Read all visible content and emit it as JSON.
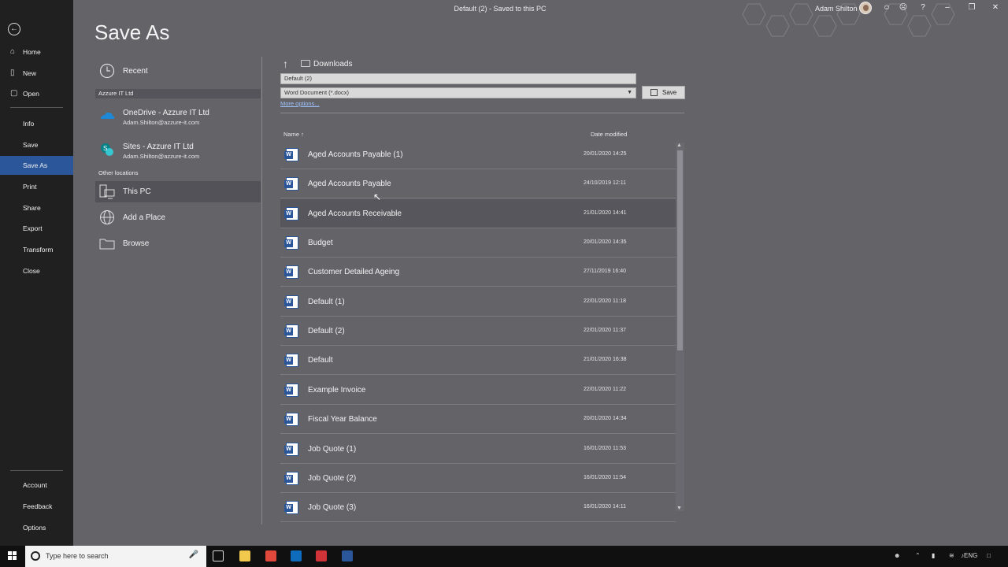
{
  "titlebar": {
    "doc_title": "Default (2)  -  Saved to this PC",
    "user_name": "Adam Shilton",
    "icons": [
      "smiley-icon",
      "frown-icon",
      "help-icon",
      "minimize-icon",
      "restore-icon",
      "close-icon"
    ],
    "glyphs": [
      "☺",
      "☹",
      "?",
      "–",
      "❐",
      "✕"
    ]
  },
  "nav": {
    "back_glyph": "←",
    "items": [
      {
        "label": "Home",
        "icon": "home-icon",
        "glyph": "⌂"
      },
      {
        "label": "New",
        "icon": "new-doc-icon",
        "glyph": "▯"
      },
      {
        "label": "Open",
        "icon": "folder-open-icon",
        "glyph": "▢"
      },
      {
        "label": "Info"
      },
      {
        "label": "Save"
      },
      {
        "label": "Save As"
      },
      {
        "label": "Print"
      },
      {
        "label": "Share"
      },
      {
        "label": "Export"
      },
      {
        "label": "Transform"
      },
      {
        "label": "Close"
      },
      {
        "label": "Account"
      },
      {
        "label": "Feedback"
      },
      {
        "label": "Options"
      }
    ]
  },
  "page": {
    "title": "Save As"
  },
  "locations": {
    "recent": "Recent",
    "group_org": "Azzure IT Ltd",
    "onedrive": {
      "name": "OneDrive - Azzure IT Ltd",
      "email": "Adam.Shilton@azzure-it.com"
    },
    "sites": {
      "name": "Sites - Azzure IT Ltd",
      "email": "Adam.Shilton@azzure-it.com"
    },
    "group_other": "Other locations",
    "this_pc": "This PC",
    "add_place": "Add a Place",
    "browse": "Browse"
  },
  "save_panel": {
    "folder": "Downloads",
    "filename": "Default (2)",
    "filetype": "Word Document (*.docx)",
    "more_options": "More options...",
    "save_label": "Save",
    "col_name": "Name",
    "col_date": "Date modified"
  },
  "files": [
    {
      "name": "Aged Accounts Payable (1)",
      "date": "20/01/2020 14:25"
    },
    {
      "name": "Aged Accounts Payable",
      "date": "24/10/2019 12:11"
    },
    {
      "name": "Aged Accounts Receivable",
      "date": "21/01/2020 14:41"
    },
    {
      "name": "Budget",
      "date": "20/01/2020 14:35"
    },
    {
      "name": "Customer Detailed Ageing",
      "date": "27/11/2019 16:40"
    },
    {
      "name": "Default (1)",
      "date": "22/01/2020 11:18"
    },
    {
      "name": "Default (2)",
      "date": "22/01/2020 11:37"
    },
    {
      "name": "Default",
      "date": "21/01/2020 16:38"
    },
    {
      "name": "Example Invoice",
      "date": "22/01/2020 11:22"
    },
    {
      "name": "Fiscal Year Balance",
      "date": "20/01/2020 14:34"
    },
    {
      "name": "Job Quote (1)",
      "date": "16/01/2020 11:53"
    },
    {
      "name": "Job Quote (2)",
      "date": "16/01/2020 11:54"
    },
    {
      "name": "Job Quote (3)",
      "date": "16/01/2020 14:11"
    }
  ],
  "taskbar": {
    "search_placeholder": "Type here to search",
    "apps": [
      {
        "name": "task-view-icon",
        "color": "#dddddd"
      },
      {
        "name": "file-explorer-icon",
        "color": "#f2c94c"
      },
      {
        "name": "chrome-icon",
        "color": "#e0483b"
      },
      {
        "name": "outlook-icon",
        "color": "#0f6cbd"
      },
      {
        "name": "app-red-icon",
        "color": "#d13438"
      },
      {
        "name": "word-icon",
        "color": "#2b579a"
      }
    ],
    "language": "ENG"
  },
  "colors": {
    "accent": "#2b579a",
    "nav_bg": "#202020",
    "page_bg": "#646368"
  }
}
